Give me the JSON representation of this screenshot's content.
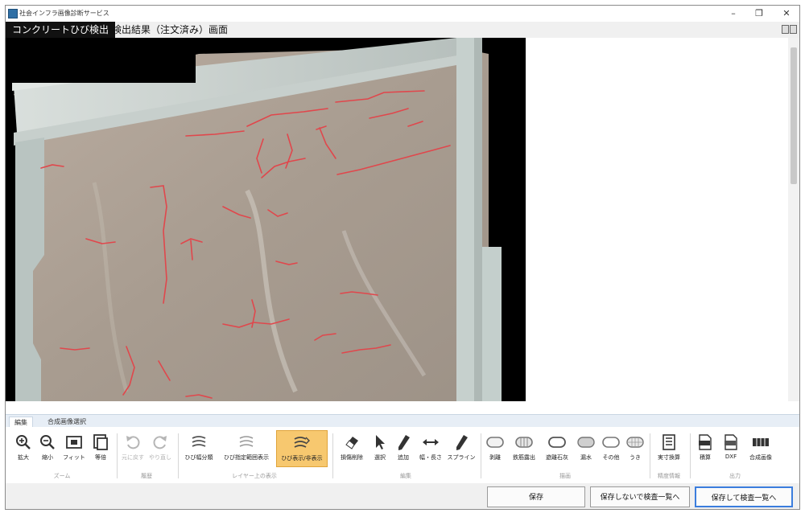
{
  "window": {
    "title": "社会インフラ画像診断サービス",
    "controls": {
      "minimize": "–",
      "maximize": "❐",
      "close": "✕"
    }
  },
  "header": {
    "active_label": "コンクリートひび検出",
    "title": "検出結果（注文済み）画面"
  },
  "ribbon": {
    "tabs": [
      {
        "label": "編集",
        "active": true
      },
      {
        "label": "合成画像選択",
        "active": false
      }
    ],
    "groups": [
      {
        "label": "ズーム",
        "tools": [
          {
            "label": "拡大",
            "icon": "zoom-in-icon"
          },
          {
            "label": "縮小",
            "icon": "zoom-out-icon"
          },
          {
            "label": "フィット",
            "icon": "fit-icon"
          },
          {
            "label": "等倍",
            "icon": "actual-size-icon"
          }
        ]
      },
      {
        "label": "履歴",
        "tools": [
          {
            "label": "元に戻す",
            "icon": "undo-icon",
            "disabled": true
          },
          {
            "label": "やり直し",
            "icon": "redo-icon",
            "disabled": true
          }
        ]
      },
      {
        "label": "レイヤー上の表示",
        "tools": [
          {
            "label": "ひび幅分類",
            "icon": "crack-width-icon"
          },
          {
            "label": "ひび指定範囲表示",
            "icon": "crack-range-icon"
          },
          {
            "label": "ひび表示/非表示",
            "icon": "crack-toggle-icon",
            "highlighted": true
          }
        ]
      },
      {
        "label": "編集",
        "tools": [
          {
            "label": "損傷削除",
            "icon": "eraser-icon"
          },
          {
            "label": "選択",
            "icon": "pointer-icon"
          },
          {
            "label": "追加",
            "icon": "pen-icon"
          },
          {
            "label": "幅・長さ",
            "icon": "measure-icon"
          },
          {
            "label": "スプライン",
            "icon": "spline-pen-icon"
          }
        ]
      },
      {
        "label": "描画",
        "tools": [
          {
            "label": "剥離",
            "icon": "peel-shape-icon"
          },
          {
            "label": "鉄筋露出",
            "icon": "rebar-shape-icon"
          },
          {
            "label": "遊離石灰",
            "icon": "efflorescence-shape-icon"
          },
          {
            "label": "漏水",
            "icon": "leak-shape-icon"
          },
          {
            "label": "その他",
            "icon": "other-shape-icon"
          },
          {
            "label": "うき",
            "icon": "float-shape-icon"
          }
        ]
      },
      {
        "label": "精度情報",
        "tools": [
          {
            "label": "実寸換算",
            "icon": "scale-icon"
          }
        ]
      },
      {
        "label": "出力",
        "tools": [
          {
            "label": "積算",
            "icon": "csv-icon"
          },
          {
            "label": "DXF",
            "icon": "dxf-icon"
          },
          {
            "label": "合成画像",
            "icon": "composite-image-icon"
          }
        ]
      }
    ]
  },
  "footer": {
    "save": "保存",
    "save_no_inspect": "保存しないで検査一覧へ",
    "save_and_inspect": "保存して検査一覧へ"
  },
  "colors": {
    "crack": "#e0474c",
    "highlight": "#f7c86f",
    "header_active": "#111111"
  }
}
